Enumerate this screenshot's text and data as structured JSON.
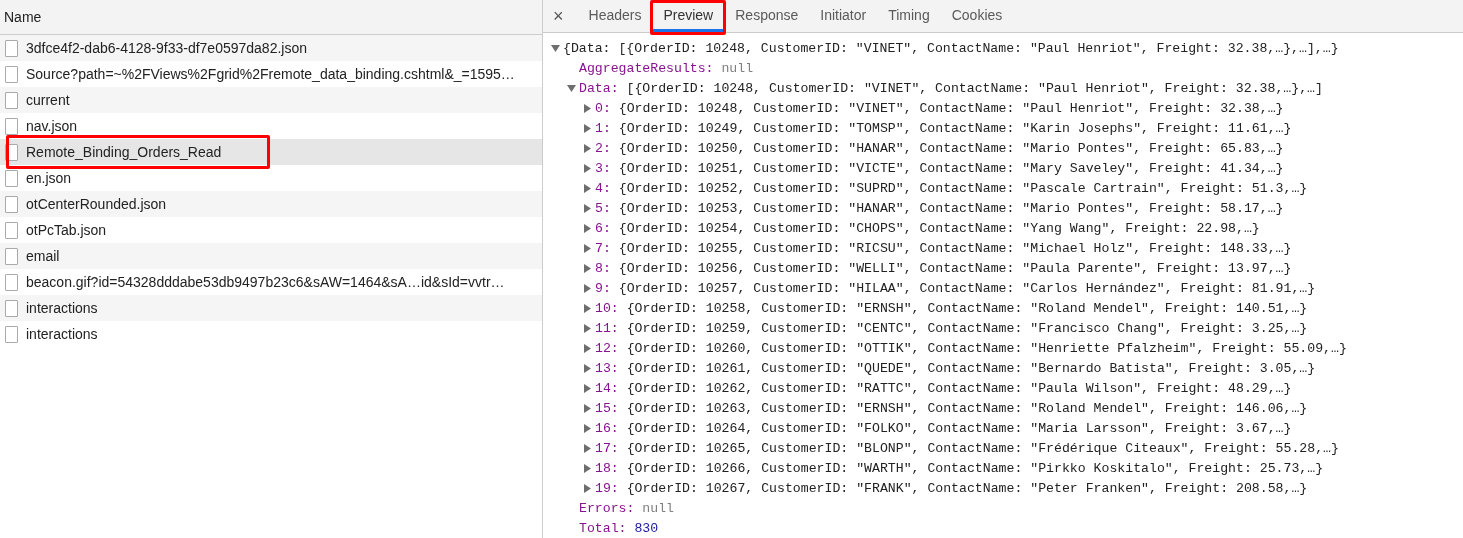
{
  "requests": {
    "header": "Name",
    "items": [
      {
        "name": "3dfce4f2-dab6-4128-9f33-df7e0597da82.json",
        "selected": false,
        "annotated": false
      },
      {
        "name": "Source?path=~%2FViews%2Fgrid%2Fremote_data_binding.cshtml&_=1595…",
        "selected": false,
        "annotated": false
      },
      {
        "name": "current",
        "selected": false,
        "annotated": false
      },
      {
        "name": "nav.json",
        "selected": false,
        "annotated": false
      },
      {
        "name": "Remote_Binding_Orders_Read",
        "selected": true,
        "annotated": true
      },
      {
        "name": "en.json",
        "selected": false,
        "annotated": false
      },
      {
        "name": "otCenterRounded.json",
        "selected": false,
        "annotated": false
      },
      {
        "name": "otPcTab.json",
        "selected": false,
        "annotated": false
      },
      {
        "name": "email",
        "selected": false,
        "annotated": false
      },
      {
        "name": "beacon.gif?id=54328dddabe53db9497b23c6&sAW=1464&sA…id&sId=vvtr…",
        "selected": false,
        "annotated": false
      },
      {
        "name": "interactions",
        "selected": false,
        "annotated": false
      },
      {
        "name": "interactions",
        "selected": false,
        "annotated": false
      }
    ]
  },
  "details": {
    "close": "×",
    "tabs": [
      {
        "label": "Headers",
        "selected": false,
        "annotated": false
      },
      {
        "label": "Preview",
        "selected": true,
        "annotated": true
      },
      {
        "label": "Response",
        "selected": false,
        "annotated": false
      },
      {
        "label": "Initiator",
        "selected": false,
        "annotated": false
      },
      {
        "label": "Timing",
        "selected": false,
        "annotated": false
      },
      {
        "label": "Cookies",
        "selected": false,
        "annotated": false
      }
    ],
    "preview": {
      "summary": "{Data: [{OrderID: 10248, CustomerID: \"VINET\", ContactName: \"Paul Henriot\", Freight: 32.38,…},…],…}",
      "expanded": true,
      "children": [
        {
          "key": "AggregateResults:",
          "value": "null",
          "kind": "null"
        },
        {
          "key": "Data:",
          "value": "[{OrderID: 10248, CustomerID: \"VINET\", ContactName: \"Paul Henriot\", Freight: 32.38,…},…]",
          "kind": "object",
          "expanded": true,
          "children": [
            {
              "key": "0:",
              "value": "{OrderID: 10248, CustomerID: \"VINET\", ContactName: \"Paul Henriot\", Freight: 32.38,…}",
              "kind": "object",
              "expanded": false
            },
            {
              "key": "1:",
              "value": "{OrderID: 10249, CustomerID: \"TOMSP\", ContactName: \"Karin Josephs\", Freight: 11.61,…}",
              "kind": "object",
              "expanded": false
            },
            {
              "key": "2:",
              "value": "{OrderID: 10250, CustomerID: \"HANAR\", ContactName: \"Mario Pontes\", Freight: 65.83,…}",
              "kind": "object",
              "expanded": false
            },
            {
              "key": "3:",
              "value": "{OrderID: 10251, CustomerID: \"VICTE\", ContactName: \"Mary Saveley\", Freight: 41.34,…}",
              "kind": "object",
              "expanded": false
            },
            {
              "key": "4:",
              "value": "{OrderID: 10252, CustomerID: \"SUPRD\", ContactName: \"Pascale Cartrain\", Freight: 51.3,…}",
              "kind": "object",
              "expanded": false
            },
            {
              "key": "5:",
              "value": "{OrderID: 10253, CustomerID: \"HANAR\", ContactName: \"Mario Pontes\", Freight: 58.17,…}",
              "kind": "object",
              "expanded": false
            },
            {
              "key": "6:",
              "value": "{OrderID: 10254, CustomerID: \"CHOPS\", ContactName: \"Yang Wang\", Freight: 22.98,…}",
              "kind": "object",
              "expanded": false
            },
            {
              "key": "7:",
              "value": "{OrderID: 10255, CustomerID: \"RICSU\", ContactName: \"Michael Holz\", Freight: 148.33,…}",
              "kind": "object",
              "expanded": false
            },
            {
              "key": "8:",
              "value": "{OrderID: 10256, CustomerID: \"WELLI\", ContactName: \"Paula Parente\", Freight: 13.97,…}",
              "kind": "object",
              "expanded": false
            },
            {
              "key": "9:",
              "value": "{OrderID: 10257, CustomerID: \"HILAA\", ContactName: \"Carlos Hernández\", Freight: 81.91,…}",
              "kind": "object",
              "expanded": false
            },
            {
              "key": "10:",
              "value": "{OrderID: 10258, CustomerID: \"ERNSH\", ContactName: \"Roland Mendel\", Freight: 140.51,…}",
              "kind": "object",
              "expanded": false
            },
            {
              "key": "11:",
              "value": "{OrderID: 10259, CustomerID: \"CENTC\", ContactName: \"Francisco Chang\", Freight: 3.25,…}",
              "kind": "object",
              "expanded": false
            },
            {
              "key": "12:",
              "value": "{OrderID: 10260, CustomerID: \"OTTIK\", ContactName: \"Henriette Pfalzheim\", Freight: 55.09,…}",
              "kind": "object",
              "expanded": false
            },
            {
              "key": "13:",
              "value": "{OrderID: 10261, CustomerID: \"QUEDE\", ContactName: \"Bernardo Batista\", Freight: 3.05,…}",
              "kind": "object",
              "expanded": false
            },
            {
              "key": "14:",
              "value": "{OrderID: 10262, CustomerID: \"RATTC\", ContactName: \"Paula Wilson\", Freight: 48.29,…}",
              "kind": "object",
              "expanded": false
            },
            {
              "key": "15:",
              "value": "{OrderID: 10263, CustomerID: \"ERNSH\", ContactName: \"Roland Mendel\", Freight: 146.06,…}",
              "kind": "object",
              "expanded": false
            },
            {
              "key": "16:",
              "value": "{OrderID: 10264, CustomerID: \"FOLKO\", ContactName: \"Maria Larsson\", Freight: 3.67,…}",
              "kind": "object",
              "expanded": false
            },
            {
              "key": "17:",
              "value": "{OrderID: 10265, CustomerID: \"BLONP\", ContactName: \"Frédérique Citeaux\", Freight: 55.28,…}",
              "kind": "object",
              "expanded": false
            },
            {
              "key": "18:",
              "value": "{OrderID: 10266, CustomerID: \"WARTH\", ContactName: \"Pirkko Koskitalo\", Freight: 25.73,…}",
              "kind": "object",
              "expanded": false
            },
            {
              "key": "19:",
              "value": "{OrderID: 10267, CustomerID: \"FRANK\", ContactName: \"Peter Franken\", Freight: 208.58,…}",
              "kind": "object",
              "expanded": false
            }
          ]
        },
        {
          "key": "Errors:",
          "value": "null",
          "kind": "null"
        },
        {
          "key": "Total:",
          "value": "830",
          "kind": "number"
        }
      ]
    }
  }
}
